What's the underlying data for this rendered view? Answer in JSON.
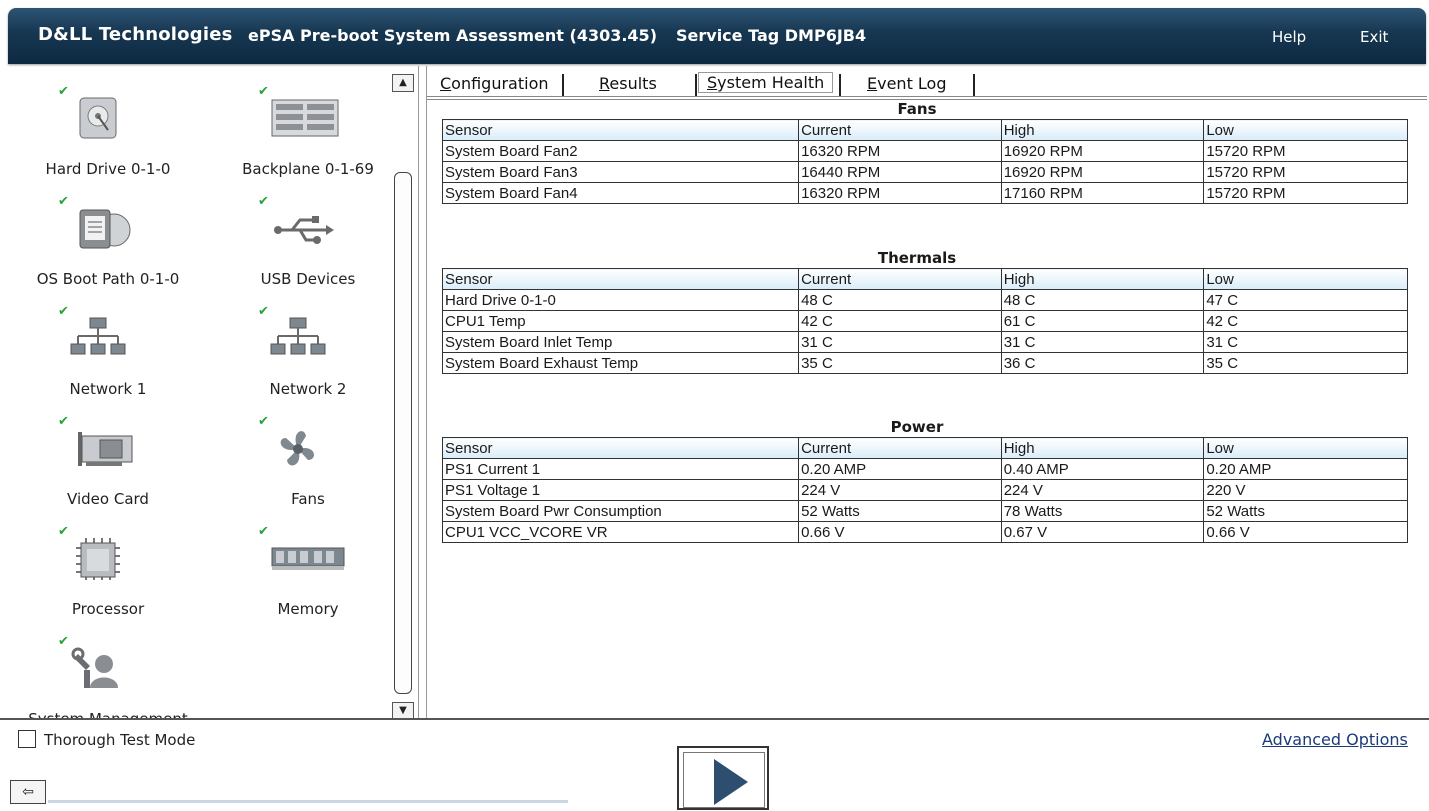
{
  "header": {
    "logo": "D&LL Technologies",
    "title": "ePSA Pre-boot System Assessment (4303.45)",
    "service_tag": "Service Tag DMP6JB4",
    "help": "Help",
    "exit": "Exit"
  },
  "devices": [
    {
      "label": "Hard Drive 0-1-0",
      "icon": "hard-drive-icon",
      "status": "pass"
    },
    {
      "label": "Backplane 0-1-69",
      "icon": "backplane-icon",
      "status": "pass"
    },
    {
      "label": "OS Boot Path 0-1-0",
      "icon": "os-boot-path-icon",
      "status": "pass"
    },
    {
      "label": "USB Devices",
      "icon": "usb-icon",
      "status": "pass"
    },
    {
      "label": "Network 1",
      "icon": "network-icon",
      "status": "pass"
    },
    {
      "label": "Network 2",
      "icon": "network-icon",
      "status": "pass"
    },
    {
      "label": "Video Card",
      "icon": "video-card-icon",
      "status": "pass"
    },
    {
      "label": "Fans",
      "icon": "fan-icon",
      "status": "pass"
    },
    {
      "label": "Processor",
      "icon": "processor-icon",
      "status": "pass"
    },
    {
      "label": "Memory",
      "icon": "memory-icon",
      "status": "pass"
    },
    {
      "label": "System Management",
      "icon": "system-management-icon",
      "status": "pass"
    }
  ],
  "tabs": [
    {
      "label": "Configuration",
      "underline": "C",
      "rest": "onfiguration",
      "active": false
    },
    {
      "label": "Results",
      "underline": "R",
      "rest": "esults",
      "active": false
    },
    {
      "label": "System Health",
      "underline": "S",
      "rest": "ystem Health",
      "active": true
    },
    {
      "label": "Event Log",
      "underline": "E",
      "rest": "vent Log",
      "active": false
    }
  ],
  "columns": [
    "Sensor",
    "Current",
    "High",
    "Low"
  ],
  "sections": {
    "fans": {
      "title": "Fans",
      "rows": [
        [
          "System Board Fan2",
          "16320 RPM",
          "16920 RPM",
          "15720 RPM"
        ],
        [
          "System Board Fan3",
          "16440 RPM",
          "16920 RPM",
          "15720 RPM"
        ],
        [
          "System Board Fan4",
          "16320 RPM",
          "17160 RPM",
          "15720 RPM"
        ]
      ]
    },
    "thermals": {
      "title": "Thermals",
      "rows": [
        [
          "Hard Drive 0-1-0",
          "48 C",
          "48 C",
          "47 C"
        ],
        [
          "CPU1 Temp",
          "42 C",
          "61 C",
          "42 C"
        ],
        [
          "System Board Inlet Temp",
          "31 C",
          "31 C",
          "31 C"
        ],
        [
          "System Board Exhaust Temp",
          "35 C",
          "36 C",
          "35 C"
        ]
      ]
    },
    "power": {
      "title": "Power",
      "rows": [
        [
          "PS1 Current 1",
          "0.20 AMP",
          "0.40 AMP",
          "0.20 AMP"
        ],
        [
          "PS1 Voltage 1",
          "224 V",
          "224 V",
          "220 V"
        ],
        [
          "System Board Pwr Consumption",
          "52 Watts",
          "78 Watts",
          "52 Watts"
        ],
        [
          "CPU1 VCC_VCORE VR",
          "0.66 V",
          "0.67 V",
          "0.66 V"
        ]
      ]
    }
  },
  "footer": {
    "thorough_test_mode": "Thorough Test Mode",
    "thorough_checked": false,
    "advanced_options": "Advanced Options"
  },
  "colors": {
    "header_bg": "#163650",
    "check_green": "#27a33a",
    "table_header": "#d8ecf8",
    "link": "#1a3a7a"
  }
}
